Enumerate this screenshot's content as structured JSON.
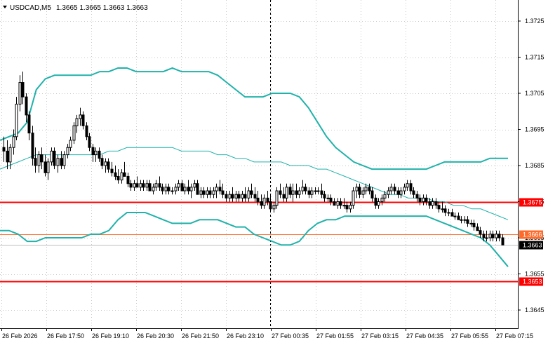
{
  "header": {
    "symbol_timeframe": "USDCAD,M5",
    "ohlc": "1.3665 1.3665 1.3663 1.3663"
  },
  "chart_data": {
    "type": "candlestick",
    "y_ticks": [
      "1.3725",
      "1.3715",
      "1.3705",
      "1.3695",
      "1.3685",
      "1.3675",
      "1.3665",
      "1.3655",
      "1.3645"
    ],
    "x_labels": [
      "26 Feb 2026",
      "26 Feb 17:50",
      "26 Feb 19:10",
      "26 Feb 20:30",
      "26 Feb 21:50",
      "26 Feb 23:10",
      "27 Feb 00:35",
      "27 Feb 01:55",
      "27 Feb 03:15",
      "27 Feb 04:35",
      "27 Feb 05:55",
      "27 Feb 07:15"
    ],
    "ylim": [
      1.3639,
      1.3732
    ],
    "horizontal_levels": [
      {
        "label": "1.3675",
        "value": 1.3675,
        "color": "#ff0000"
      },
      {
        "label": "1.3666",
        "value": 1.3666,
        "color": "#ff6a2a"
      },
      {
        "label": "1.3653",
        "value": 1.3653,
        "color": "#ff0000"
      }
    ],
    "current_price": {
      "label": "1.3663",
      "value": 1.3663
    },
    "period_separator_at_bar": 84,
    "bollinger_upper": [
      1.3692,
      1.3693,
      1.3694,
      1.3697,
      1.3706,
      1.3709,
      1.371,
      1.371,
      1.371,
      1.371,
      1.371,
      1.3711,
      1.3711,
      1.3712,
      1.3712,
      1.3711,
      1.3711,
      1.3711,
      1.3711,
      1.3712,
      1.3711,
      1.3711,
      1.3711,
      1.3711,
      1.371,
      1.3708,
      1.3706,
      1.3704,
      1.3704,
      1.3704,
      1.3705,
      1.3705,
      1.3705,
      1.3704,
      1.3701,
      1.3697,
      1.3693,
      1.369,
      1.3688,
      1.3686,
      1.3685,
      1.3684,
      1.3684,
      1.3684,
      1.3684,
      1.3684,
      1.3684,
      1.3684,
      1.3685,
      1.3686,
      1.3686,
      1.3686,
      1.3686,
      1.3686,
      1.3687,
      1.3687,
      1.3687
    ],
    "bollinger_middle": [
      1.3684,
      1.3685,
      1.3686,
      1.3687,
      1.3688,
      1.3688,
      1.3688,
      1.3688,
      1.3688,
      1.3688,
      1.3688,
      1.3688,
      1.3689,
      1.3689,
      1.369,
      1.369,
      1.369,
      1.369,
      1.369,
      1.369,
      1.3689,
      1.3689,
      1.3689,
      1.3689,
      1.3688,
      1.3688,
      1.3687,
      1.3687,
      1.3686,
      1.3686,
      1.3686,
      1.3686,
      1.3685,
      1.3685,
      1.3685,
      1.3684,
      1.3684,
      1.3683,
      1.3682,
      1.3681,
      1.368,
      1.3679,
      1.3678,
      1.3677,
      1.3677,
      1.3676,
      1.3676,
      1.3676,
      1.3675,
      1.3675,
      1.3674,
      1.3674,
      1.3673,
      1.3673,
      1.3672,
      1.3671,
      1.367
    ],
    "bollinger_lower": [
      1.3667,
      1.3667,
      1.3666,
      1.3664,
      1.3664,
      1.3665,
      1.3665,
      1.3665,
      1.3665,
      1.3665,
      1.3666,
      1.3666,
      1.3667,
      1.367,
      1.3672,
      1.3672,
      1.3672,
      1.3671,
      1.367,
      1.3669,
      1.3669,
      1.3669,
      1.367,
      1.367,
      1.367,
      1.3669,
      1.3668,
      1.3668,
      1.3666,
      1.3665,
      1.3664,
      1.3663,
      1.3663,
      1.3664,
      1.3667,
      1.3669,
      1.367,
      1.367,
      1.3671,
      1.3671,
      1.3671,
      1.3671,
      1.3671,
      1.3671,
      1.3671,
      1.3671,
      1.3671,
      1.3671,
      1.367,
      1.3669,
      1.3668,
      1.3667,
      1.3666,
      1.3665,
      1.3663,
      1.366,
      1.3657
    ],
    "candles": [
      [
        1.369,
        1.3693,
        1.3686,
        1.3689
      ],
      [
        1.3689,
        1.3692,
        1.3684,
        1.3686
      ],
      [
        1.3686,
        1.3691,
        1.3684,
        1.369
      ],
      [
        1.369,
        1.3695,
        1.3688,
        1.3693
      ],
      [
        1.3693,
        1.3704,
        1.3692,
        1.3702
      ],
      [
        1.3702,
        1.371,
        1.37,
        1.3708
      ],
      [
        1.3708,
        1.3711,
        1.3702,
        1.3704
      ],
      [
        1.3704,
        1.3705,
        1.3697,
        1.3699
      ],
      [
        1.3699,
        1.37,
        1.3692,
        1.3694
      ],
      [
        1.3694,
        1.3696,
        1.3685,
        1.3687
      ],
      [
        1.3687,
        1.369,
        1.3683,
        1.3685
      ],
      [
        1.3685,
        1.3689,
        1.3683,
        1.3688
      ],
      [
        1.3688,
        1.369,
        1.3684,
        1.3686
      ],
      [
        1.3686,
        1.3688,
        1.3682,
        1.3683
      ],
      [
        1.3683,
        1.3687,
        1.3681,
        1.3686
      ],
      [
        1.3686,
        1.369,
        1.3685,
        1.3689
      ],
      [
        1.3689,
        1.369,
        1.3684,
        1.3685
      ],
      [
        1.3685,
        1.3688,
        1.3683,
        1.3687
      ],
      [
        1.3687,
        1.3689,
        1.3684,
        1.3685
      ],
      [
        1.3685,
        1.3689,
        1.3684,
        1.3688
      ],
      [
        1.3688,
        1.3691,
        1.3687,
        1.369
      ],
      [
        1.369,
        1.3693,
        1.3689,
        1.3692
      ],
      [
        1.3692,
        1.3697,
        1.3691,
        1.3696
      ],
      [
        1.3696,
        1.3699,
        1.3694,
        1.3698
      ],
      [
        1.3698,
        1.3701,
        1.3696,
        1.3699
      ],
      [
        1.3699,
        1.37,
        1.3695,
        1.3696
      ],
      [
        1.3696,
        1.3697,
        1.3692,
        1.3693
      ],
      [
        1.3693,
        1.3694,
        1.3689,
        1.369
      ],
      [
        1.369,
        1.3691,
        1.3686,
        1.3688
      ],
      [
        1.3688,
        1.369,
        1.3686,
        1.3689
      ],
      [
        1.3689,
        1.369,
        1.3686,
        1.3687
      ],
      [
        1.3687,
        1.3688,
        1.3684,
        1.3685
      ],
      [
        1.3685,
        1.3687,
        1.3683,
        1.3686
      ],
      [
        1.3686,
        1.3687,
        1.3683,
        1.3684
      ],
      [
        1.3684,
        1.3686,
        1.3682,
        1.3683
      ],
      [
        1.3683,
        1.3685,
        1.3681,
        1.3682
      ],
      [
        1.3682,
        1.3684,
        1.368,
        1.3681
      ],
      [
        1.3681,
        1.3684,
        1.368,
        1.3683
      ],
      [
        1.3683,
        1.3686,
        1.3682,
        1.3682
      ],
      [
        1.3682,
        1.3683,
        1.3679,
        1.368
      ],
      [
        1.368,
        1.3681,
        1.3678,
        1.3679
      ],
      [
        1.3679,
        1.3681,
        1.3678,
        1.368
      ],
      [
        1.368,
        1.3682,
        1.3679,
        1.3679
      ],
      [
        1.3679,
        1.3681,
        1.3678,
        1.368
      ],
      [
        1.368,
        1.3681,
        1.3678,
        1.3679
      ],
      [
        1.3679,
        1.3681,
        1.3678,
        1.368
      ],
      [
        1.368,
        1.3681,
        1.3678,
        1.3678
      ],
      [
        1.3678,
        1.368,
        1.3677,
        1.3679
      ],
      [
        1.3679,
        1.3681,
        1.3678,
        1.368
      ],
      [
        1.368,
        1.3682,
        1.3678,
        1.3679
      ],
      [
        1.3679,
        1.368,
        1.3677,
        1.3678
      ],
      [
        1.3678,
        1.368,
        1.3677,
        1.3679
      ],
      [
        1.3679,
        1.368,
        1.3677,
        1.3678
      ],
      [
        1.3678,
        1.3679,
        1.3677,
        1.3678
      ],
      [
        1.3678,
        1.368,
        1.3677,
        1.3679
      ],
      [
        1.3679,
        1.3681,
        1.3678,
        1.368
      ],
      [
        1.368,
        1.3681,
        1.3678,
        1.3678
      ],
      [
        1.3678,
        1.368,
        1.3677,
        1.3679
      ],
      [
        1.3679,
        1.3681,
        1.3677,
        1.3678
      ],
      [
        1.3678,
        1.368,
        1.3676,
        1.3679
      ],
      [
        1.3679,
        1.3681,
        1.3678,
        1.368
      ],
      [
        1.368,
        1.3681,
        1.3677,
        1.3677
      ],
      [
        1.3677,
        1.3679,
        1.3676,
        1.3678
      ],
      [
        1.3678,
        1.3679,
        1.3676,
        1.3677
      ],
      [
        1.3677,
        1.3679,
        1.3676,
        1.3678
      ],
      [
        1.3678,
        1.3679,
        1.3676,
        1.3677
      ],
      [
        1.3677,
        1.3679,
        1.3676,
        1.3678
      ],
      [
        1.3678,
        1.368,
        1.3676,
        1.3679
      ],
      [
        1.3679,
        1.3681,
        1.3677,
        1.3678
      ],
      [
        1.3678,
        1.368,
        1.3676,
        1.3677
      ],
      [
        1.3677,
        1.3678,
        1.3675,
        1.3676
      ],
      [
        1.3676,
        1.3678,
        1.3675,
        1.3677
      ],
      [
        1.3677,
        1.3679,
        1.3675,
        1.3676
      ],
      [
        1.3676,
        1.3678,
        1.3675,
        1.3677
      ],
      [
        1.3677,
        1.3678,
        1.3675,
        1.3676
      ],
      [
        1.3676,
        1.3678,
        1.3675,
        1.3677
      ],
      [
        1.3677,
        1.3679,
        1.3675,
        1.3676
      ],
      [
        1.3676,
        1.3679,
        1.3675,
        1.3678
      ],
      [
        1.3678,
        1.368,
        1.3676,
        1.3677
      ],
      [
        1.3677,
        1.3679,
        1.3675,
        1.3676
      ],
      [
        1.3676,
        1.3678,
        1.3674,
        1.3675
      ],
      [
        1.3675,
        1.3677,
        1.3673,
        1.3674
      ],
      [
        1.3674,
        1.3677,
        1.3673,
        1.3676
      ],
      [
        1.3676,
        1.3678,
        1.3674,
        1.3675
      ],
      [
        1.3675,
        1.3677,
        1.3672,
        1.3673
      ],
      [
        1.3673,
        1.3675,
        1.3672,
        1.3674
      ],
      [
        1.3674,
        1.3679,
        1.3673,
        1.3678
      ],
      [
        1.3678,
        1.368,
        1.3676,
        1.3677
      ],
      [
        1.3677,
        1.3679,
        1.3675,
        1.3676
      ],
      [
        1.3676,
        1.368,
        1.3675,
        1.3679
      ],
      [
        1.3679,
        1.368,
        1.3676,
        1.3677
      ],
      [
        1.3677,
        1.368,
        1.3675,
        1.3678
      ],
      [
        1.3678,
        1.368,
        1.3676,
        1.3677
      ],
      [
        1.3677,
        1.3679,
        1.3676,
        1.3678
      ],
      [
        1.3678,
        1.3681,
        1.3677,
        1.3679
      ],
      [
        1.3679,
        1.368,
        1.3677,
        1.3678
      ],
      [
        1.3678,
        1.3679,
        1.3676,
        1.3677
      ],
      [
        1.3677,
        1.3679,
        1.3676,
        1.3678
      ],
      [
        1.3678,
        1.3679,
        1.3677,
        1.3678
      ],
      [
        1.3678,
        1.3679,
        1.3677,
        1.3678
      ],
      [
        1.3678,
        1.368,
        1.3676,
        1.3677
      ],
      [
        1.3677,
        1.3678,
        1.3675,
        1.3676
      ],
      [
        1.3676,
        1.3677,
        1.3675,
        1.3676
      ],
      [
        1.3676,
        1.3677,
        1.3674,
        1.3675
      ],
      [
        1.3675,
        1.3676,
        1.3674,
        1.3674
      ],
      [
        1.3674,
        1.3676,
        1.3673,
        1.3675
      ],
      [
        1.3675,
        1.3676,
        1.3673,
        1.3674
      ],
      [
        1.3674,
        1.3676,
        1.3673,
        1.3674
      ],
      [
        1.3674,
        1.3675,
        1.3672,
        1.3673
      ],
      [
        1.3673,
        1.3675,
        1.3672,
        1.3674
      ],
      [
        1.3674,
        1.3679,
        1.3673,
        1.3678
      ],
      [
        1.3678,
        1.368,
        1.3676,
        1.3679
      ],
      [
        1.3679,
        1.368,
        1.3676,
        1.3677
      ],
      [
        1.3677,
        1.3679,
        1.3676,
        1.3678
      ],
      [
        1.3678,
        1.368,
        1.3677,
        1.3679
      ],
      [
        1.3679,
        1.368,
        1.3677,
        1.3678
      ],
      [
        1.3678,
        1.3679,
        1.3675,
        1.3676
      ],
      [
        1.3676,
        1.3677,
        1.3673,
        1.3674
      ],
      [
        1.3674,
        1.3676,
        1.3673,
        1.3675
      ],
      [
        1.3675,
        1.3677,
        1.3674,
        1.3676
      ],
      [
        1.3676,
        1.3678,
        1.3675,
        1.3677
      ],
      [
        1.3677,
        1.3679,
        1.3676,
        1.3678
      ],
      [
        1.3678,
        1.368,
        1.3677,
        1.3679
      ],
      [
        1.3679,
        1.368,
        1.3677,
        1.3678
      ],
      [
        1.3678,
        1.3679,
        1.3676,
        1.3677
      ],
      [
        1.3677,
        1.3679,
        1.3676,
        1.3678
      ],
      [
        1.3678,
        1.368,
        1.3677,
        1.3679
      ],
      [
        1.3679,
        1.3681,
        1.3678,
        1.368
      ],
      [
        1.368,
        1.3681,
        1.3677,
        1.3678
      ],
      [
        1.3678,
        1.3679,
        1.3676,
        1.3677
      ],
      [
        1.3677,
        1.3678,
        1.3675,
        1.3676
      ],
      [
        1.3676,
        1.3677,
        1.3674,
        1.3675
      ],
      [
        1.3675,
        1.3677,
        1.3674,
        1.3676
      ],
      [
        1.3676,
        1.3677,
        1.3674,
        1.3675
      ],
      [
        1.3675,
        1.3676,
        1.3673,
        1.3674
      ],
      [
        1.3674,
        1.3676,
        1.3673,
        1.3675
      ],
      [
        1.3675,
        1.3676,
        1.3673,
        1.3674
      ],
      [
        1.3674,
        1.3675,
        1.3672,
        1.3673
      ],
      [
        1.3673,
        1.3675,
        1.3672,
        1.3673
      ],
      [
        1.3673,
        1.3674,
        1.3671,
        1.3672
      ],
      [
        1.3672,
        1.3673,
        1.3671,
        1.3672
      ],
      [
        1.3672,
        1.3673,
        1.3671,
        1.3671
      ],
      [
        1.3671,
        1.3672,
        1.367,
        1.3671
      ],
      [
        1.3671,
        1.3672,
        1.367,
        1.367
      ],
      [
        1.367,
        1.3671,
        1.3669,
        1.367
      ],
      [
        1.367,
        1.3671,
        1.3669,
        1.367
      ],
      [
        1.367,
        1.3671,
        1.3668,
        1.3669
      ],
      [
        1.3669,
        1.367,
        1.3668,
        1.3669
      ],
      [
        1.3669,
        1.367,
        1.3667,
        1.3668
      ],
      [
        1.3668,
        1.3669,
        1.3667,
        1.3667
      ],
      [
        1.3667,
        1.3668,
        1.3665,
        1.3666
      ],
      [
        1.3666,
        1.3667,
        1.3664,
        1.3665
      ],
      [
        1.3665,
        1.3667,
        1.3664,
        1.3665
      ],
      [
        1.3665,
        1.3667,
        1.3664,
        1.3666
      ],
      [
        1.3666,
        1.3667,
        1.3664,
        1.3665
      ],
      [
        1.3665,
        1.3667,
        1.3664,
        1.3666
      ],
      [
        1.3666,
        1.3667,
        1.3664,
        1.3665
      ],
      [
        1.3665,
        1.3666,
        1.3663,
        1.3663
      ]
    ]
  }
}
